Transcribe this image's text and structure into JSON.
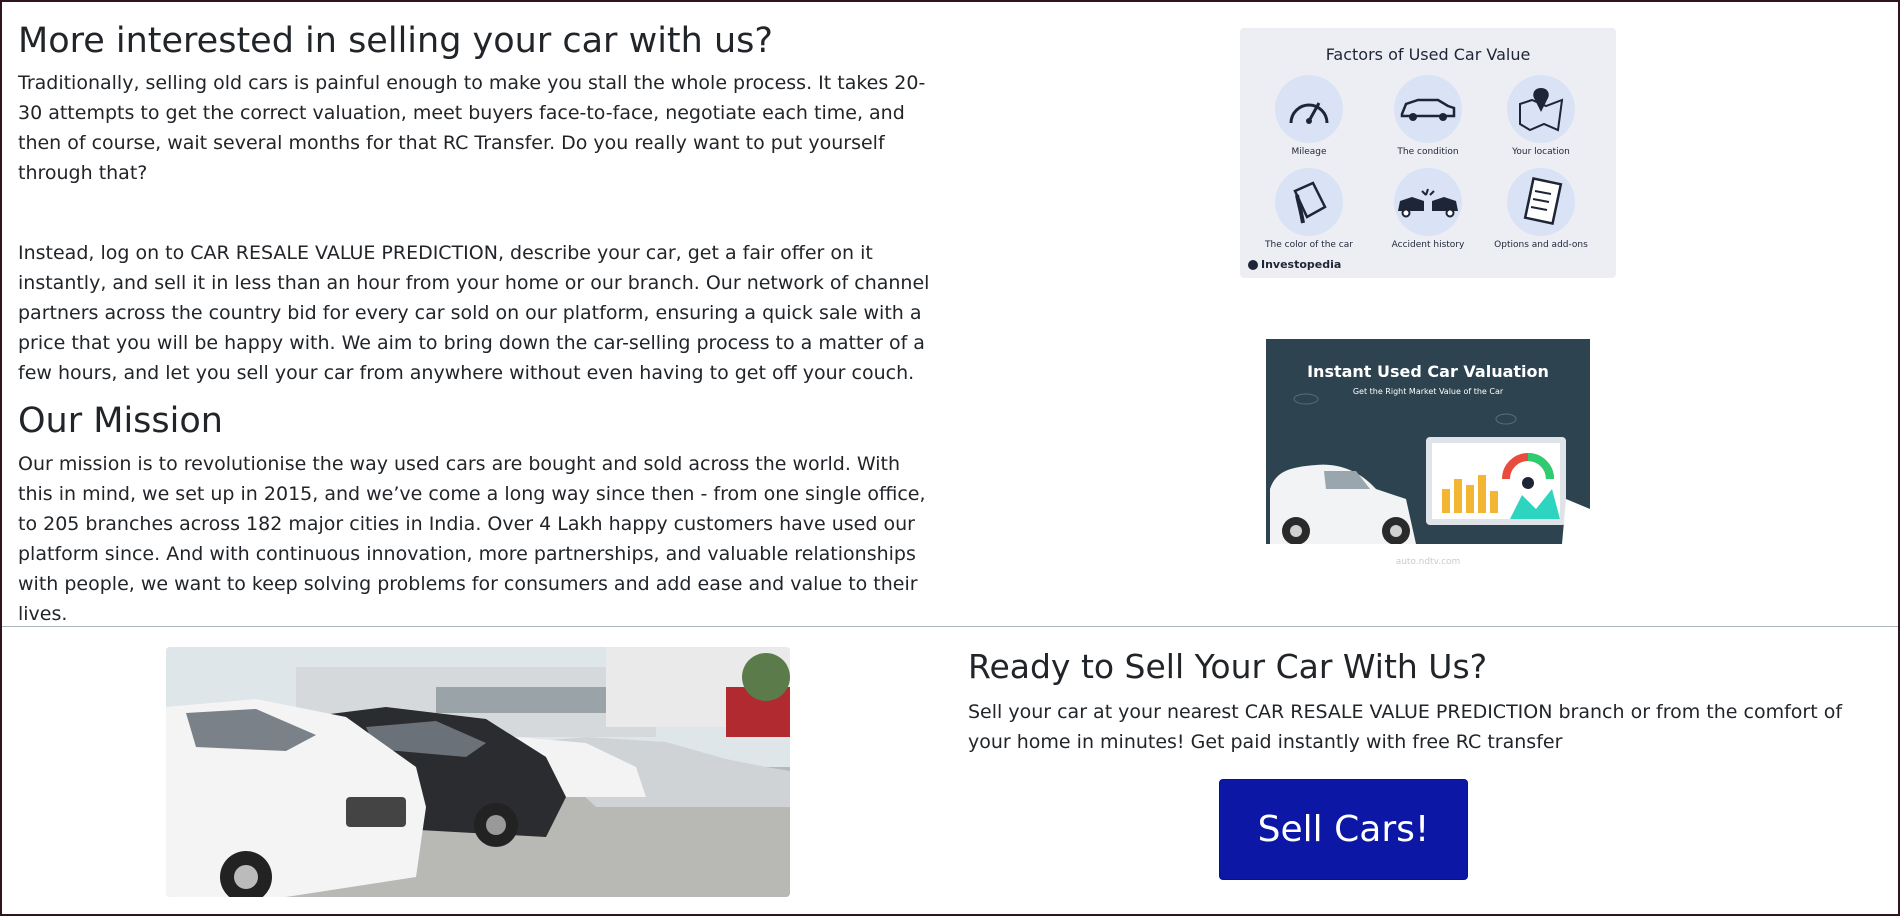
{
  "about": {
    "heading": "More interested in selling your car with us?",
    "para1": "Traditionally, selling old cars is painful enough to make you stall the whole process. It takes 20-30 attempts to get the correct valuation, meet buyers face-to-face, negotiate each time, and then of course, wait several months for that RC Transfer. Do you really want to put yourself through that?",
    "para2": "Instead, log on to CAR RESALE VALUE PREDICTION, describe your car, get a fair offer on it instantly, and sell it in less than an hour from your home or our branch. Our network of channel partners across the country bid for every car sold on our platform, ensuring a quick sale with a price that you will be happy with. We aim to bring down the car-selling process to a matter of a few hours, and let you sell your car from anywhere without even having to get off your couch."
  },
  "mission": {
    "heading": "Our Mission",
    "para": "Our mission is to revolutionise the way used cars are bought and sold across the world. With this in mind, we set up in 2015, and we’ve come a long way since then - from one single office, to 205 branches across 182 major cities in India. Over 4 Lakh happy customers have used our platform since. And with continuous innovation, more partnerships, and valuable relationships with people, we want to keep solving problems for consumers and add ease and value to their lives."
  },
  "factors_graphic": {
    "title": "Factors of Used Car Value",
    "items": [
      {
        "label": "Mileage",
        "icon": "speedometer-icon"
      },
      {
        "label": "The condition",
        "icon": "car-icon"
      },
      {
        "label": "Your location",
        "icon": "map-pin-icon"
      },
      {
        "label": "The color of the car",
        "icon": "paint-bucket-icon"
      },
      {
        "label": "Accident history",
        "icon": "car-crash-icon"
      },
      {
        "label": "Options and add-ons",
        "icon": "checklist-icon"
      }
    ],
    "brand": "Investopedia"
  },
  "valuation_graphic": {
    "title": "Instant Used Car Valuation",
    "subtitle": "Get the Right Market Value of the Car",
    "source": "auto.ndtv.com"
  },
  "sell": {
    "heading": "Ready to Sell Your Car With Us?",
    "para": "Sell your car at your nearest CAR RESALE VALUE PREDICTION branch or from the comfort of your home in minutes! Get paid instantly with free RC transfer",
    "button_label": "Sell Cars!"
  },
  "colors": {
    "button_bg": "#0c18a5",
    "text": "#212529",
    "graphic_bg": "#2e4350"
  }
}
